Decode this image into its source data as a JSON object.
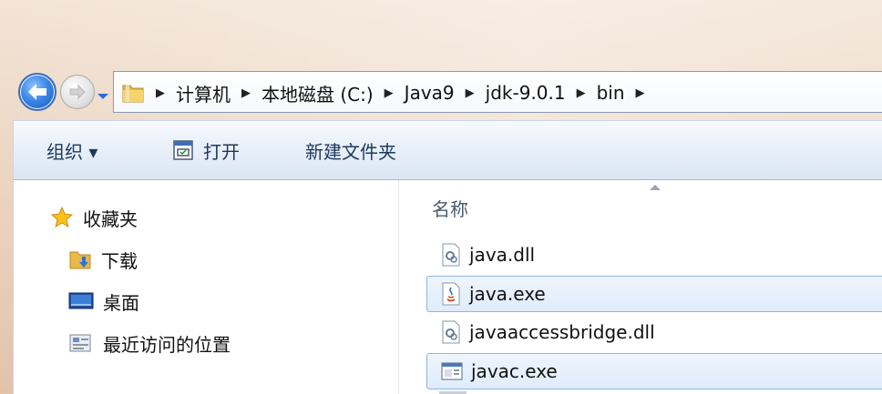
{
  "address_bar": {
    "crumbs": [
      "计算机",
      "本地磁盘 (C:)",
      "Java9",
      "jdk-9.0.1",
      "bin"
    ]
  },
  "toolbar": {
    "organize_label": "组织 ▾",
    "open_label": "打开",
    "new_folder_label": "新建文件夹"
  },
  "nav_pane": {
    "favorites_label": "收藏夹",
    "items": [
      {
        "label": "下载",
        "icon": "downloads-folder-icon"
      },
      {
        "label": "桌面",
        "icon": "desktop-icon"
      },
      {
        "label": "最近访问的位置",
        "icon": "recent-places-icon"
      }
    ]
  },
  "file_list": {
    "column_name": "名称",
    "files": [
      {
        "name": "java.dll",
        "icon": "dll-file-icon",
        "selected": false
      },
      {
        "name": "java.exe",
        "icon": "java-exe-icon",
        "selected": true
      },
      {
        "name": "javaaccessbridge.dll",
        "icon": "dll-file-icon",
        "selected": false
      },
      {
        "name": "javac.exe",
        "icon": "exe-file-icon",
        "selected": true
      }
    ]
  },
  "colors": {
    "selection_fill": "#dfecfb",
    "selection_border": "#8fb4e3",
    "toolbar_text": "#1e395b",
    "back_button": "#3c86e6"
  }
}
